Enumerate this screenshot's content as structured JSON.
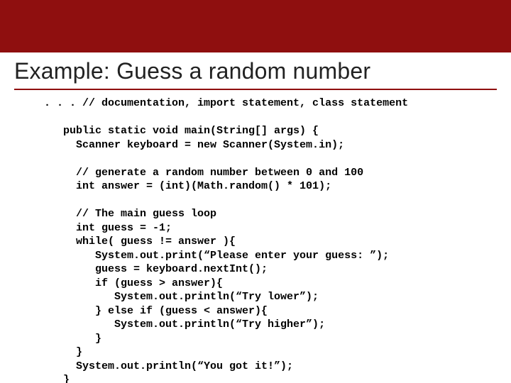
{
  "slide": {
    "title": "Example: Guess a random number",
    "code": ". . . // documentation, import statement, class statement\n\n   public static void main(String[] args) {\n     Scanner keyboard = new Scanner(System.in);\n\n     // generate a random number between 0 and 100\n     int answer = (int)(Math.random() * 101);\n\n     // The main guess loop\n     int guess = -1;\n     while( guess != answer ){\n        System.out.print(“Please enter your guess: ”);\n        guess = keyboard.nextInt();\n        if (guess > answer){\n           System.out.println(“Try lower”);\n        } else if (guess < answer){\n           System.out.println(“Try higher”);\n        }\n     }\n     System.out.println(“You got it!”);\n   }"
  }
}
